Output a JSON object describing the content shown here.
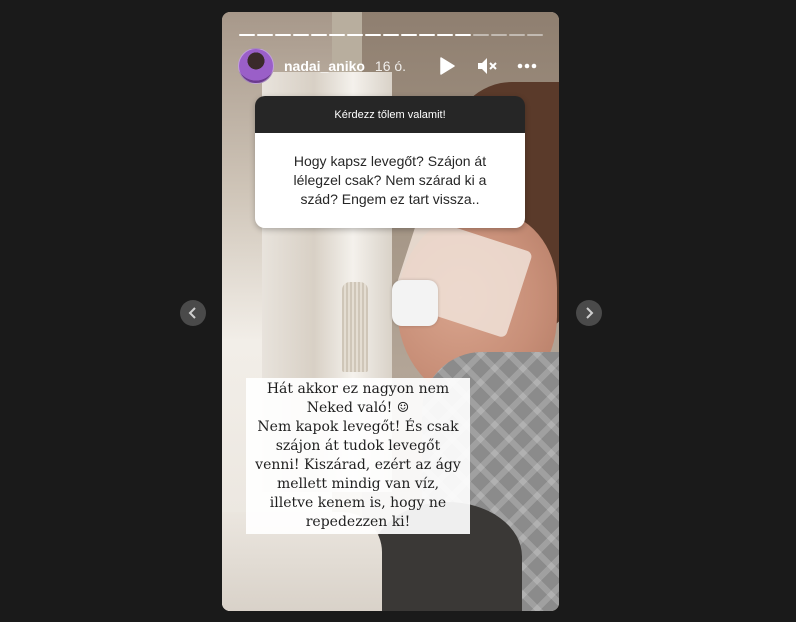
{
  "story": {
    "username": "nadai_aniko",
    "time": "16 ó.",
    "progress": {
      "segments_total": 17,
      "segments_done": 13
    }
  },
  "icons": {
    "play": "play-icon",
    "mute": "mute-icon",
    "more": "more-icon",
    "prev": "chevron-left-icon",
    "next": "chevron-right-icon"
  },
  "question": {
    "header": "Kérdezz tőlem valamit!",
    "text": "Hogy kapsz levegőt? Szájon át lélegzel csak? Nem szárad ki a szád? Engem ez tart vissza.."
  },
  "answer": {
    "text": "Hát akkor ez nagyon nem\nNeked való! ☺\nNem kapok levegőt! És csak\nszájon át tudok levegőt\nvenni! Kiszárad, ezért az ágy\nmellett mindig van víz,\nilletve kenem is, hogy ne\nrepedezzen ki!"
  },
  "colors": {
    "page_bg": "#1a1a1a",
    "question_header_bg": "#262626",
    "nav_bg": "#4a4a4a"
  }
}
